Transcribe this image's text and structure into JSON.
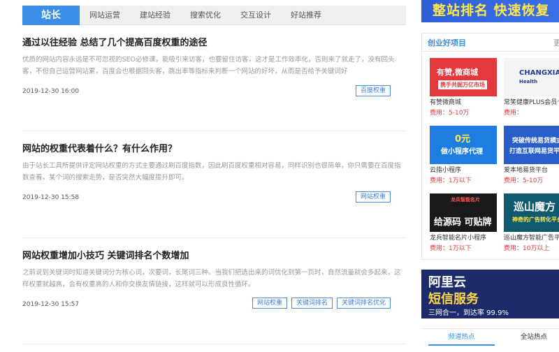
{
  "nav": {
    "brand": "站长",
    "links": [
      "网站运营",
      "建站经验",
      "搜索优化",
      "交互设计",
      "好站推荐"
    ]
  },
  "articles": [
    {
      "title": "通过以往经验 总结了几个提高百度权重的途径",
      "excerpt": "优质的网站内容永远是不可忽视的SEO必修课，能吸引来访客，也要留住访客，这才是工作效率化，否则来了就走了，没有回头客，不但自己运营网站累，百度会也根据回头客，跳出率等指标来判断一个网站的好坏，从而是否给予关键词好",
      "date": "2019-12-30 16:00",
      "tags": [
        "百度权重"
      ]
    },
    {
      "title": "网站的权重代表着什么？有什么作用？",
      "excerpt": "由于站长工具所提供评定网站权重的方式主要通过刷百度指数，因此刷百度权重相对容易，同样识别也很简单，你只需要在百度指数查看，某个词的搜索走势，是否突然大幅度提升即可。",
      "date": "2019-12-30 15:58",
      "tags": [
        "网站权重"
      ]
    },
    {
      "title": "网站权重增加小技巧 关键词排名个数增加",
      "excerpt": "之前说到关键词时知道关键词分为核心词，次要词，长尾词三种。当我们把选出来的词优化到第一页时，自然流量就会多起来，这样权重就越高，会有权重高的人和你交换友情链接，这样就可以形成良性循环。",
      "date": "2019-12-30 15:57",
      "tags": [
        "网站权重",
        "关键词排名",
        "关键词排名优化"
      ]
    }
  ],
  "sidebar": {
    "top_banner": "整站排名 快速恢复",
    "section_title": "创业好项目",
    "section_more": "更",
    "fee_label": "费用：",
    "cards": [
      {
        "img": [
          "有赞,微商城",
          "携手共掘万亿市场"
        ],
        "name": "有赞微商城",
        "fee": "5-10万",
        "bg": "#e4393c"
      },
      {
        "img": [
          "CHANGXIAO",
          "Health"
        ],
        "name": "常笑健康PLUS会员卡",
        "fee": "",
        "bg": "#f4f4f4"
      },
      {
        "img": [
          "0元",
          "做小程序代理"
        ],
        "name": "云指小程序",
        "fee": "1万以下",
        "bg": "#1e7de0"
      },
      {
        "img": [
          "突破传统易货模式",
          "打造互联网易货平台"
        ],
        "name": "爱本地易货平台",
        "fee": "5-10万",
        "bg": "#2a5ec8"
      },
      {
        "img": [
          "龙兵智能名片",
          "给源码 可贴牌"
        ],
        "name": "龙兵智能名片小程序",
        "fee": "1万以下",
        "bg": "#1a1a1a"
      },
      {
        "img": [
          "巡山魔方",
          "神奇的广告转化平台"
        ],
        "name": "巡山魔方智能广告平台",
        "fee": "10万以上",
        "bg": "#0f5a6e"
      }
    ],
    "ali_banner": {
      "line1": "阿里云",
      "line2": "短信服务",
      "line3": "三网合一，到达率 99.9%"
    },
    "tabs": [
      "频道热点",
      "全站热点"
    ]
  },
  "colors": {
    "accent": "#3a8ee6",
    "fee": "#e4393c",
    "tag_border": "#4a90d9"
  }
}
